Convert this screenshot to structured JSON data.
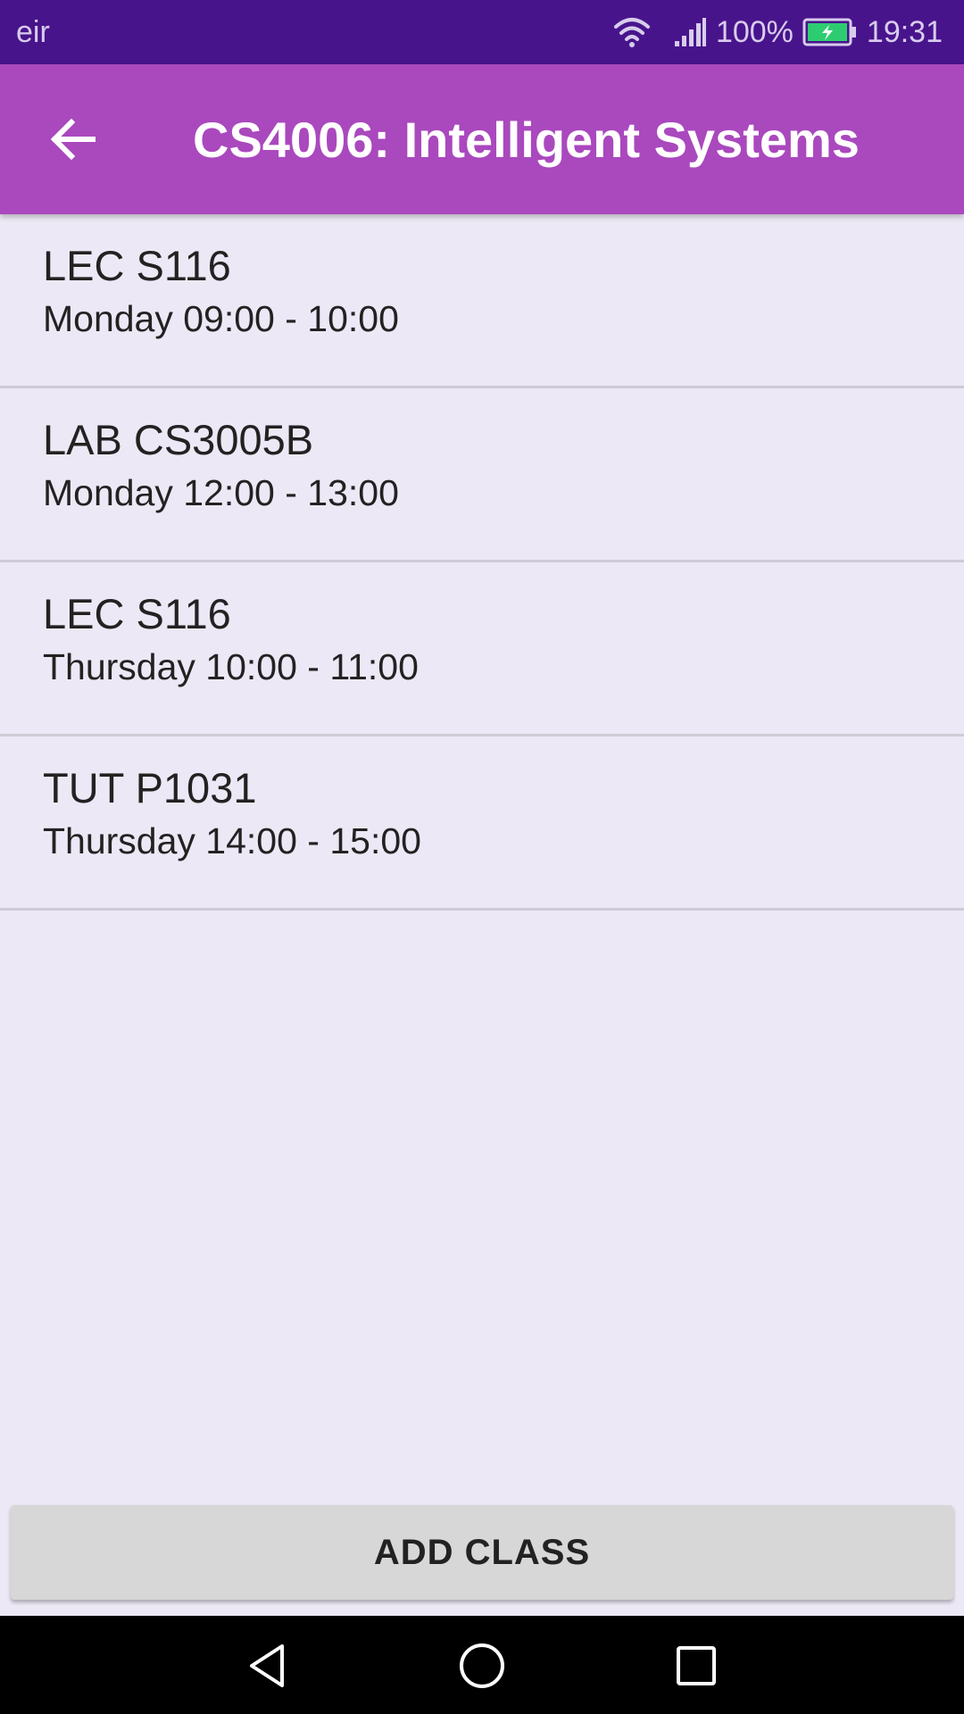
{
  "status_bar": {
    "carrier": "eir",
    "battery_percent": "100%",
    "time": "19:31",
    "icons": [
      "wifi-icon",
      "signal-icon",
      "battery-charging-icon"
    ],
    "colors": {
      "background": "#48148C",
      "battery_fill": "#2ECC71"
    }
  },
  "app_bar": {
    "back_icon": "arrow-back-icon",
    "title": "CS4006: Intelligent Systems",
    "color": "#AA48BE"
  },
  "classes": [
    {
      "name": "LEC S116",
      "time": "Monday 09:00 - 10:00"
    },
    {
      "name": "LAB CS3005B",
      "time": "Monday 12:00 - 13:00"
    },
    {
      "name": "LEC S116",
      "time": "Thursday 10:00 - 11:00"
    },
    {
      "name": "TUT P1031",
      "time": "Thursday 14:00 - 15:00"
    }
  ],
  "add_button": {
    "label": "ADD CLASS"
  },
  "nav_bar": {
    "icons": [
      "nav-back-icon",
      "nav-home-icon",
      "nav-recent-icon"
    ]
  }
}
